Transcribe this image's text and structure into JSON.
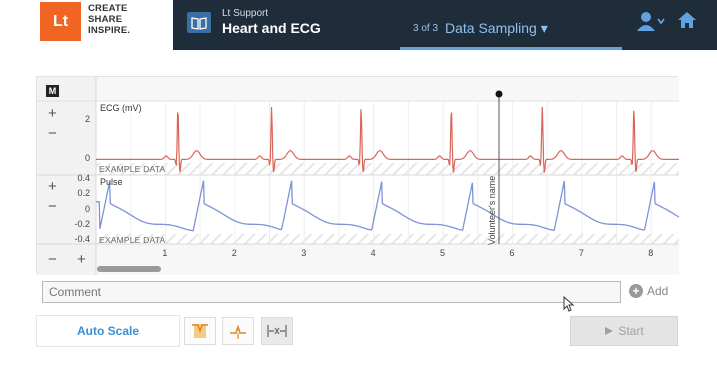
{
  "header": {
    "logo_badge": "Lt",
    "logo_lines": [
      "CREATE",
      "SHARE",
      "INSPIRE."
    ],
    "lesson_sup": "Lt Support",
    "lesson_title": "Heart and ECG",
    "step_count": "3 of 3",
    "step_name": "Data Sampling ▾",
    "icons": [
      "book-icon",
      "user-icon",
      "home-icon"
    ]
  },
  "chart_panel": {
    "marker_label": "M",
    "ecg_label": "ECG  (mV)",
    "pulse_label": "Pulse",
    "example_label": "EXAMPLE DATA",
    "volunteer_label": "Volunteer's name",
    "zoom_in": "+",
    "zoom_out": "−"
  },
  "comment": {
    "placeholder": "Comment",
    "add_label": "Add"
  },
  "toolbar": {
    "autoscale_label": "Auto Scale",
    "start_label": "Start"
  },
  "colors": {
    "ecg_trace": "#d9655a",
    "pulse_trace": "#7d93d6",
    "accent": "#3a8fd6",
    "brand": "#f06424"
  },
  "chart_data": [
    {
      "type": "line",
      "series": [
        {
          "name": "ECG",
          "values": [
            0,
            0,
            2.4,
            -0.6,
            0,
            0.4,
            0
          ]
        }
      ],
      "ylabel": "ECG  (mV)",
      "yticks": [
        "2",
        "0"
      ],
      "ylim": [
        -0.8,
        3
      ],
      "beat_times": [
        1.18,
        2.53,
        3.82,
        5.12,
        6.43,
        7.75
      ],
      "xlim": [
        0,
        8.4
      ]
    },
    {
      "type": "line",
      "series": [
        {
          "name": "Pulse",
          "values": [
            0.4,
            0.2,
            0,
            -0.2,
            -0.3
          ]
        }
      ],
      "ylabel": "Pulse",
      "yticks": [
        "0.4",
        "0.2",
        "0",
        "-0.2",
        "-0.4"
      ],
      "ylim": [
        -0.45,
        0.45
      ],
      "beat_times": [
        0.2,
        1.55,
        2.82,
        4.12,
        5.43,
        6.75,
        8.05
      ],
      "xticks": [
        "1",
        "2",
        "3",
        "4",
        "5",
        "6",
        "7",
        "8"
      ],
      "xlim": [
        0,
        8.4
      ]
    }
  ]
}
